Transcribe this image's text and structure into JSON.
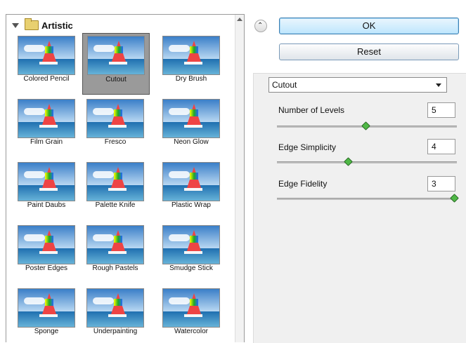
{
  "gallery": {
    "category": "Artistic",
    "filters": [
      {
        "label": "Colored Pencil",
        "selected": false
      },
      {
        "label": "Cutout",
        "selected": true
      },
      {
        "label": "Dry Brush",
        "selected": false
      },
      {
        "label": "Film Grain",
        "selected": false
      },
      {
        "label": "Fresco",
        "selected": false
      },
      {
        "label": "Neon Glow",
        "selected": false
      },
      {
        "label": "Paint Daubs",
        "selected": false
      },
      {
        "label": "Palette Knife",
        "selected": false
      },
      {
        "label": "Plastic Wrap",
        "selected": false
      },
      {
        "label": "Poster Edges",
        "selected": false
      },
      {
        "label": "Rough Pastels",
        "selected": false
      },
      {
        "label": "Smudge Stick",
        "selected": false
      },
      {
        "label": "Sponge",
        "selected": false
      },
      {
        "label": "Underpainting",
        "selected": false
      },
      {
        "label": "Watercolor",
        "selected": false
      }
    ]
  },
  "buttons": {
    "ok": "OK",
    "reset": "Reset"
  },
  "settings": {
    "filter_select": "Cutout",
    "params": [
      {
        "label": "Number of Levels",
        "value": "5",
        "slider_fraction": 0.5
      },
      {
        "label": "Edge Simplicity",
        "value": "4",
        "slider_fraction": 0.4
      },
      {
        "label": "Edge Fidelity",
        "value": "3",
        "slider_fraction": 1.0
      }
    ]
  },
  "colors": {
    "ok_button": "#bee6fd",
    "slider_knob": "#4fb846"
  }
}
